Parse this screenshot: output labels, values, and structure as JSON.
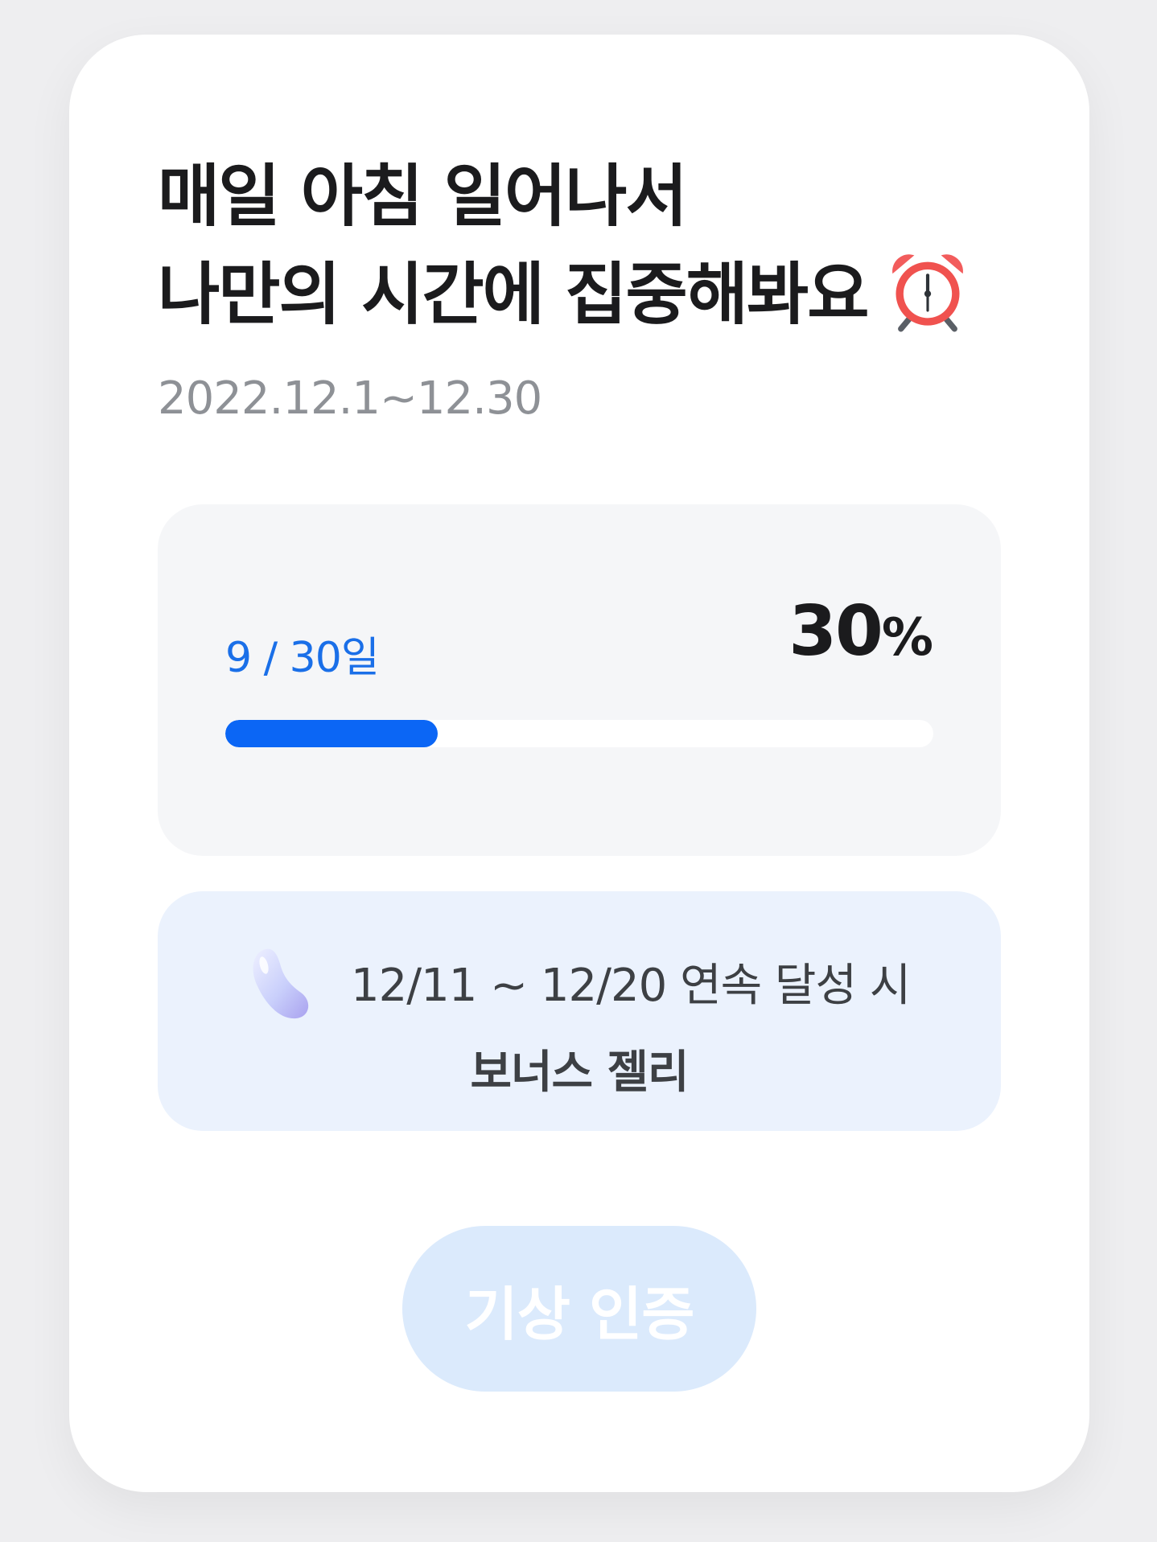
{
  "card": {
    "title_line1": "매일 아침 일어나서",
    "title_line2": "나만의 시간에 집중해봐요",
    "title_icon": "alarm-clock-icon",
    "date_range": "2022.12.1~12.30"
  },
  "progress": {
    "days_label": "9 / 30일",
    "percent_value": "30",
    "percent_sign": "%",
    "fraction": 0.3
  },
  "bonus": {
    "icon": "jelly-icon",
    "line1": "12/11 ~ 12/20 연속 달성 시",
    "line2": "보너스 젤리"
  },
  "cta": {
    "label": "기상 인증",
    "disabled": true
  },
  "colors": {
    "accent": "#0b66f5",
    "days_text": "#1a6fe8",
    "bonus_bg": "#ebf2fd",
    "cta_bg": "#dbeafc"
  }
}
